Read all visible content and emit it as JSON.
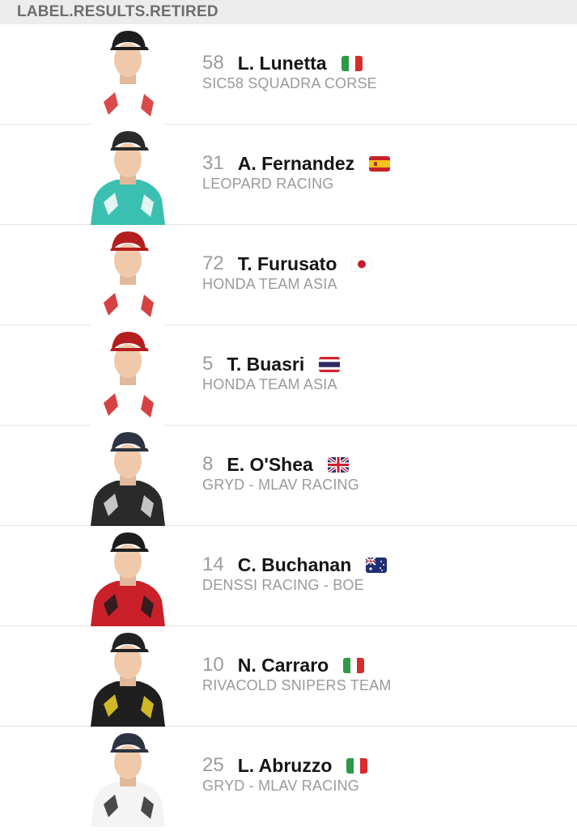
{
  "header": {
    "label": "LABEL.RESULTS.RETIRED"
  },
  "riders": [
    {
      "number": "58",
      "name": "L. Lunetta",
      "team": "SIC58 SQUADRA CORSE",
      "flag": "italy-flag-icon",
      "suit": "#ffffff",
      "accent": "#d42a2a",
      "helmet": "#1d1d1d"
    },
    {
      "number": "31",
      "name": "A. Fernandez",
      "team": "LEOPARD RACING",
      "flag": "spain-flag-icon",
      "suit": "#3bbfb0",
      "accent": "#ffffff",
      "helmet": "#2a2a2a"
    },
    {
      "number": "72",
      "name": "T. Furusato",
      "team": "HONDA TEAM ASIA",
      "flag": "japan-flag-icon",
      "suit": "#ffffff",
      "accent": "#cf2020",
      "helmet": "#b51e1e"
    },
    {
      "number": "5",
      "name": "T. Buasri",
      "team": "HONDA TEAM ASIA",
      "flag": "thailand-flag-icon",
      "suit": "#ffffff",
      "accent": "#cf2020",
      "helmet": "#b51e1e"
    },
    {
      "number": "8",
      "name": "E. O'Shea",
      "team": "GRYD - MLAV RACING",
      "flag": "uk-flag-icon",
      "suit": "#2a2a2a",
      "accent": "#e0e0e0",
      "helmet": "#2d3340"
    },
    {
      "number": "14",
      "name": "C. Buchanan",
      "team": "DENSSI RACING - BOE",
      "flag": "australia-flag-icon",
      "suit": "#c9202a",
      "accent": "#1c1c1c",
      "helmet": "#1d1d1d"
    },
    {
      "number": "10",
      "name": "N. Carraro",
      "team": "RIVACOLD SNIPERS TEAM",
      "flag": "italy-flag-icon",
      "suit": "#1f1f1f",
      "accent": "#f0d228",
      "helmet": "#222222"
    },
    {
      "number": "25",
      "name": "L. Abruzzo",
      "team": "GRYD - MLAV RACING",
      "flag": "italy-flag-icon",
      "suit": "#f4f4f4",
      "accent": "#2a2a2a",
      "helmet": "#2d3340"
    }
  ]
}
